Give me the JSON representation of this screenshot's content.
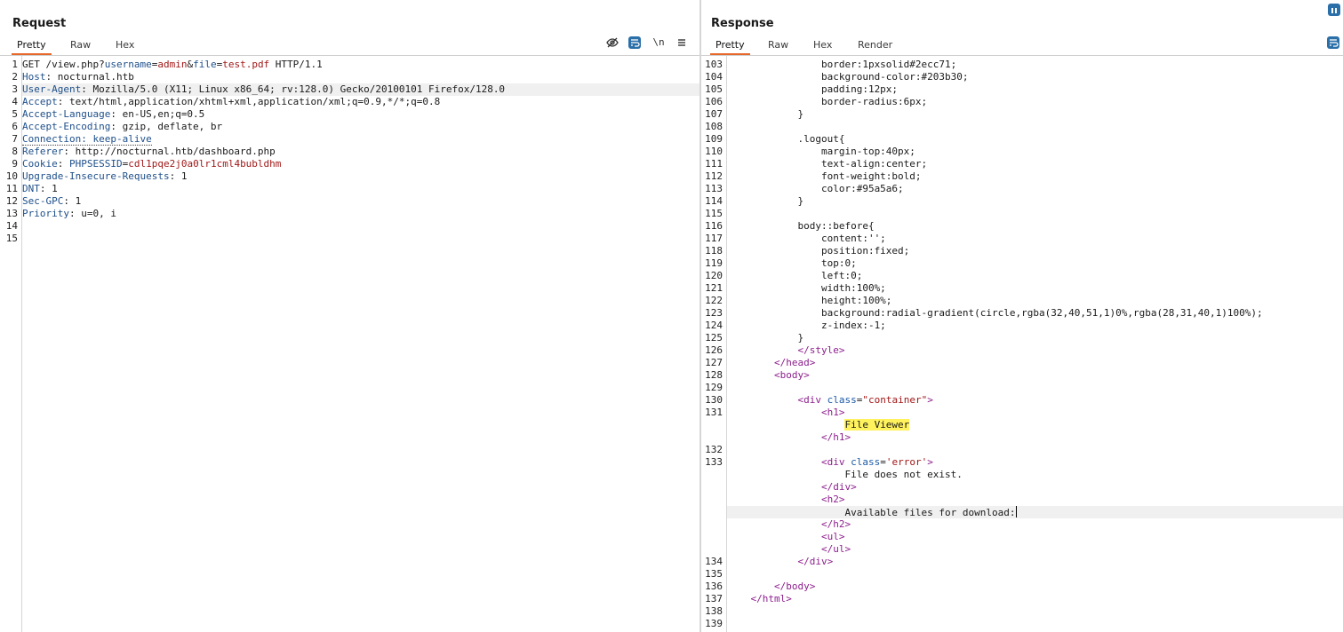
{
  "request": {
    "title": "Request",
    "tabs": [
      "Pretty",
      "Raw",
      "Hex"
    ],
    "lines": [
      {
        "n": "1",
        "html": "GET /view.php?<span class=\"c-key\">username</span>=<span class=\"c-val\">admin</span>&amp;<span class=\"c-key\">file</span>=<span class=\"c-val\">test.pdf</span> HTTP/1.1"
      },
      {
        "n": "2",
        "html": "<span class=\"c-key\">Host</span>: nocturnal.htb"
      },
      {
        "n": "3",
        "html": "<span class=\"c-key\">User-Agent</span>: Mozilla/5.0 (X11; Linux x86_64; rv:128.0) Gecko/20100101 Firefox/128.0",
        "hl": true
      },
      {
        "n": "4",
        "html": "<span class=\"c-key\">Accept</span>: text/html,application/xhtml+xml,application/xml;q=0.9,*/*;q=0.8"
      },
      {
        "n": "5",
        "html": "<span class=\"c-key\">Accept-Language</span>: en-US,en;q=0.5"
      },
      {
        "n": "6",
        "html": "<span class=\"c-key\">Accept-Encoding</span>: gzip, deflate, br"
      },
      {
        "n": "7",
        "html": "<span class=\"c-key dotted\">Connection: keep-alive</span>"
      },
      {
        "n": "8",
        "html": "<span class=\"c-key\">Referer</span>: http://nocturnal.htb/dashboard.php"
      },
      {
        "n": "9",
        "html": "<span class=\"c-key\">Cookie</span>: <span class=\"c-key\">PHPSESSID</span>=<span class=\"c-val\">cdl1pqe2j0a0lr1cml4bubldhm</span>"
      },
      {
        "n": "10",
        "html": "<span class=\"c-key\">Upgrade-Insecure-Requests</span>: 1"
      },
      {
        "n": "11",
        "html": "<span class=\"c-key\">DNT</span>: 1"
      },
      {
        "n": "12",
        "html": "<span class=\"c-key\">Sec-GPC</span>: 1"
      },
      {
        "n": "13",
        "html": "<span class=\"c-key\">Priority</span>: u=0, i"
      },
      {
        "n": "14",
        "html": ""
      },
      {
        "n": "15",
        "html": ""
      }
    ]
  },
  "response": {
    "title": "Response",
    "tabs": [
      "Pretty",
      "Raw",
      "Hex",
      "Render"
    ],
    "lines": [
      {
        "n": "103",
        "html": "                border:1pxsolid#2ecc71;"
      },
      {
        "n": "104",
        "html": "                background-color:#203b30;"
      },
      {
        "n": "105",
        "html": "                padding:12px;"
      },
      {
        "n": "106",
        "html": "                border-radius:6px;"
      },
      {
        "n": "107",
        "html": "            }"
      },
      {
        "n": "108",
        "html": ""
      },
      {
        "n": "109",
        "html": "            .logout{"
      },
      {
        "n": "110",
        "html": "                margin-top:40px;"
      },
      {
        "n": "111",
        "html": "                text-align:center;"
      },
      {
        "n": "112",
        "html": "                font-weight:bold;"
      },
      {
        "n": "113",
        "html": "                color:#95a5a6;"
      },
      {
        "n": "114",
        "html": "            }"
      },
      {
        "n": "115",
        "html": ""
      },
      {
        "n": "116",
        "html": "            body::before{"
      },
      {
        "n": "117",
        "html": "                content:'';"
      },
      {
        "n": "118",
        "html": "                position:fixed;"
      },
      {
        "n": "119",
        "html": "                top:0;"
      },
      {
        "n": "120",
        "html": "                left:0;"
      },
      {
        "n": "121",
        "html": "                width:100%;"
      },
      {
        "n": "122",
        "html": "                height:100%;"
      },
      {
        "n": "123",
        "html": "                background:radial-gradient(circle,rgba(32,40,51,1)0%,rgba(28,31,40,1)100%);"
      },
      {
        "n": "124",
        "html": "                z-index:-1;"
      },
      {
        "n": "125",
        "html": "            }"
      },
      {
        "n": "126",
        "html": "            <span class=\"c-tag\">&lt;/style&gt;</span>"
      },
      {
        "n": "127",
        "html": "        <span class=\"c-tag\">&lt;/head&gt;</span>"
      },
      {
        "n": "128",
        "html": "        <span class=\"c-tag\">&lt;body&gt;</span>"
      },
      {
        "n": "129",
        "html": ""
      },
      {
        "n": "130",
        "html": "            <span class=\"c-tag\">&lt;div</span> <span class=\"c-attr\">class</span>=<span class=\"c-str\">\"container\"</span><span class=\"c-tag\">&gt;</span>"
      },
      {
        "n": "131",
        "html": "                <span class=\"c-tag\">&lt;h1&gt;</span>"
      },
      {
        "n": "",
        "html": "                    <span class=\"mark\">File Viewer</span>"
      },
      {
        "n": "",
        "html": "                <span class=\"c-tag\">&lt;/h1&gt;</span>"
      },
      {
        "n": "132",
        "html": ""
      },
      {
        "n": "133",
        "html": "                <span class=\"c-tag\">&lt;div</span> <span class=\"c-attr\">class</span>=<span class=\"c-str\">'error'</span><span class=\"c-tag\">&gt;</span>"
      },
      {
        "n": "",
        "html": "                    File does not exist."
      },
      {
        "n": "",
        "html": "                <span class=\"c-tag\">&lt;/div&gt;</span>"
      },
      {
        "n": "",
        "html": "                <span class=\"c-tag\">&lt;h2&gt;</span>"
      },
      {
        "n": "",
        "html": "                    Available files for download:<span class=\"cursor\"></span>",
        "hl": true
      },
      {
        "n": "",
        "html": "                <span class=\"c-tag\">&lt;/h2&gt;</span>"
      },
      {
        "n": "",
        "html": "                <span class=\"c-tag\">&lt;ul&gt;</span>"
      },
      {
        "n": "",
        "html": "                <span class=\"c-tag\">&lt;/ul&gt;</span>"
      },
      {
        "n": "134",
        "html": "            <span class=\"c-tag\">&lt;/div&gt;</span>"
      },
      {
        "n": "135",
        "html": ""
      },
      {
        "n": "136",
        "html": "        <span class=\"c-tag\">&lt;/body&gt;</span>"
      },
      {
        "n": "137",
        "html": "    <span class=\"c-tag\">&lt;/html&gt;</span>"
      },
      {
        "n": "138",
        "html": ""
      },
      {
        "n": "139",
        "html": ""
      }
    ]
  },
  "toolbar": {
    "newline_label": "\\n",
    "icons": [
      "eye-off-icon",
      "wrap-icon",
      "newline-icon",
      "menu-icon"
    ]
  }
}
